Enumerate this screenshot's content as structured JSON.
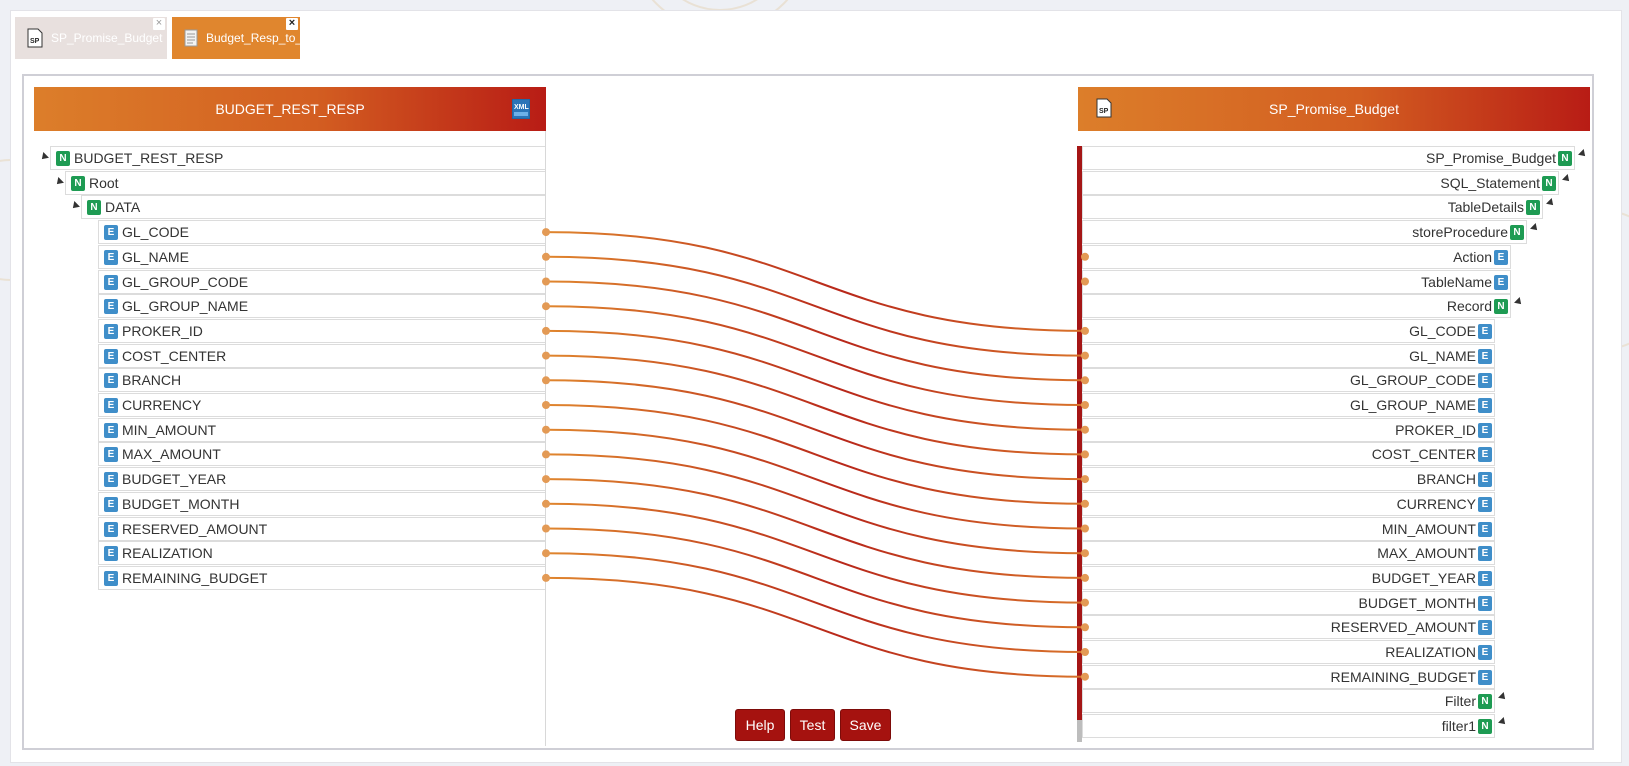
{
  "tabs": [
    {
      "label": "SP_Promise_Budget",
      "icon": "sp-file-icon",
      "active": false
    },
    {
      "label": "Budget_Resp_to_SP_Map",
      "icon": "document-icon",
      "active": true
    }
  ],
  "source_panel": {
    "title": "BUDGET_REST_RESP",
    "icon": "xml-icon",
    "tree": [
      {
        "label": "BUDGET_REST_RESP",
        "type": "N"
      },
      {
        "label": "Root",
        "type": "N"
      },
      {
        "label": "DATA",
        "type": "N"
      },
      {
        "label": "GL_CODE",
        "type": "E"
      },
      {
        "label": "GL_NAME",
        "type": "E"
      },
      {
        "label": "GL_GROUP_CODE",
        "type": "E"
      },
      {
        "label": "GL_GROUP_NAME",
        "type": "E"
      },
      {
        "label": "PROKER_ID",
        "type": "E"
      },
      {
        "label": "COST_CENTER",
        "type": "E"
      },
      {
        "label": "BRANCH",
        "type": "E"
      },
      {
        "label": "CURRENCY",
        "type": "E"
      },
      {
        "label": "MIN_AMOUNT",
        "type": "E"
      },
      {
        "label": "MAX_AMOUNT",
        "type": "E"
      },
      {
        "label": "BUDGET_YEAR",
        "type": "E"
      },
      {
        "label": "BUDGET_MONTH",
        "type": "E"
      },
      {
        "label": "RESERVED_AMOUNT",
        "type": "E"
      },
      {
        "label": "REALIZATION",
        "type": "E"
      },
      {
        "label": "REMAINING_BUDGET",
        "type": "E"
      }
    ]
  },
  "target_panel": {
    "title": "SP_Promise_Budget",
    "icon": "sp-file-icon",
    "tree": [
      {
        "label": "SP_Promise_Budget",
        "type": "N"
      },
      {
        "label": "SQL_Statement",
        "type": "N"
      },
      {
        "label": "TableDetails",
        "type": "N"
      },
      {
        "label": "storeProcedure",
        "type": "N"
      },
      {
        "label": "Action",
        "type": "E"
      },
      {
        "label": "TableName",
        "type": "E"
      },
      {
        "label": "Record",
        "type": "N"
      },
      {
        "label": "GL_CODE",
        "type": "E"
      },
      {
        "label": "GL_NAME",
        "type": "E"
      },
      {
        "label": "GL_GROUP_CODE",
        "type": "E"
      },
      {
        "label": "GL_GROUP_NAME",
        "type": "E"
      },
      {
        "label": "PROKER_ID",
        "type": "E"
      },
      {
        "label": "COST_CENTER",
        "type": "E"
      },
      {
        "label": "BRANCH",
        "type": "E"
      },
      {
        "label": "CURRENCY",
        "type": "E"
      },
      {
        "label": "MIN_AMOUNT",
        "type": "E"
      },
      {
        "label": "MAX_AMOUNT",
        "type": "E"
      },
      {
        "label": "BUDGET_YEAR",
        "type": "E"
      },
      {
        "label": "BUDGET_MONTH",
        "type": "E"
      },
      {
        "label": "RESERVED_AMOUNT",
        "type": "E"
      },
      {
        "label": "REALIZATION",
        "type": "E"
      },
      {
        "label": "REMAINING_BUDGET",
        "type": "E"
      },
      {
        "label": "Filter",
        "type": "N"
      },
      {
        "label": "filter1",
        "type": "N"
      }
    ]
  },
  "mappings": [
    {
      "from": "GL_CODE",
      "to": "GL_CODE"
    },
    {
      "from": "GL_NAME",
      "to": "GL_NAME"
    },
    {
      "from": "GL_GROUP_CODE",
      "to": "GL_GROUP_CODE"
    },
    {
      "from": "GL_GROUP_NAME",
      "to": "GL_GROUP_NAME"
    },
    {
      "from": "PROKER_ID",
      "to": "PROKER_ID"
    },
    {
      "from": "COST_CENTER",
      "to": "COST_CENTER"
    },
    {
      "from": "BRANCH",
      "to": "BRANCH"
    },
    {
      "from": "CURRENCY",
      "to": "CURRENCY"
    },
    {
      "from": "MIN_AMOUNT",
      "to": "MIN_AMOUNT"
    },
    {
      "from": "MAX_AMOUNT",
      "to": "MAX_AMOUNT"
    },
    {
      "from": "BUDGET_YEAR",
      "to": "BUDGET_YEAR"
    },
    {
      "from": "BUDGET_MONTH",
      "to": "BUDGET_MONTH"
    },
    {
      "from": "RESERVED_AMOUNT",
      "to": "RESERVED_AMOUNT"
    },
    {
      "from": "REALIZATION",
      "to": "REALIZATION"
    },
    {
      "from": "REMAINING_BUDGET",
      "to": "REMAINING_BUDGET"
    }
  ],
  "buttons": {
    "help": "Help",
    "test": "Test",
    "save": "Save"
  },
  "colors": {
    "accent": "#e0862e",
    "header_end": "#b81c15",
    "button": "#a5120f",
    "node_badge": "#1e9b53",
    "element_badge": "#3f8ec9"
  }
}
